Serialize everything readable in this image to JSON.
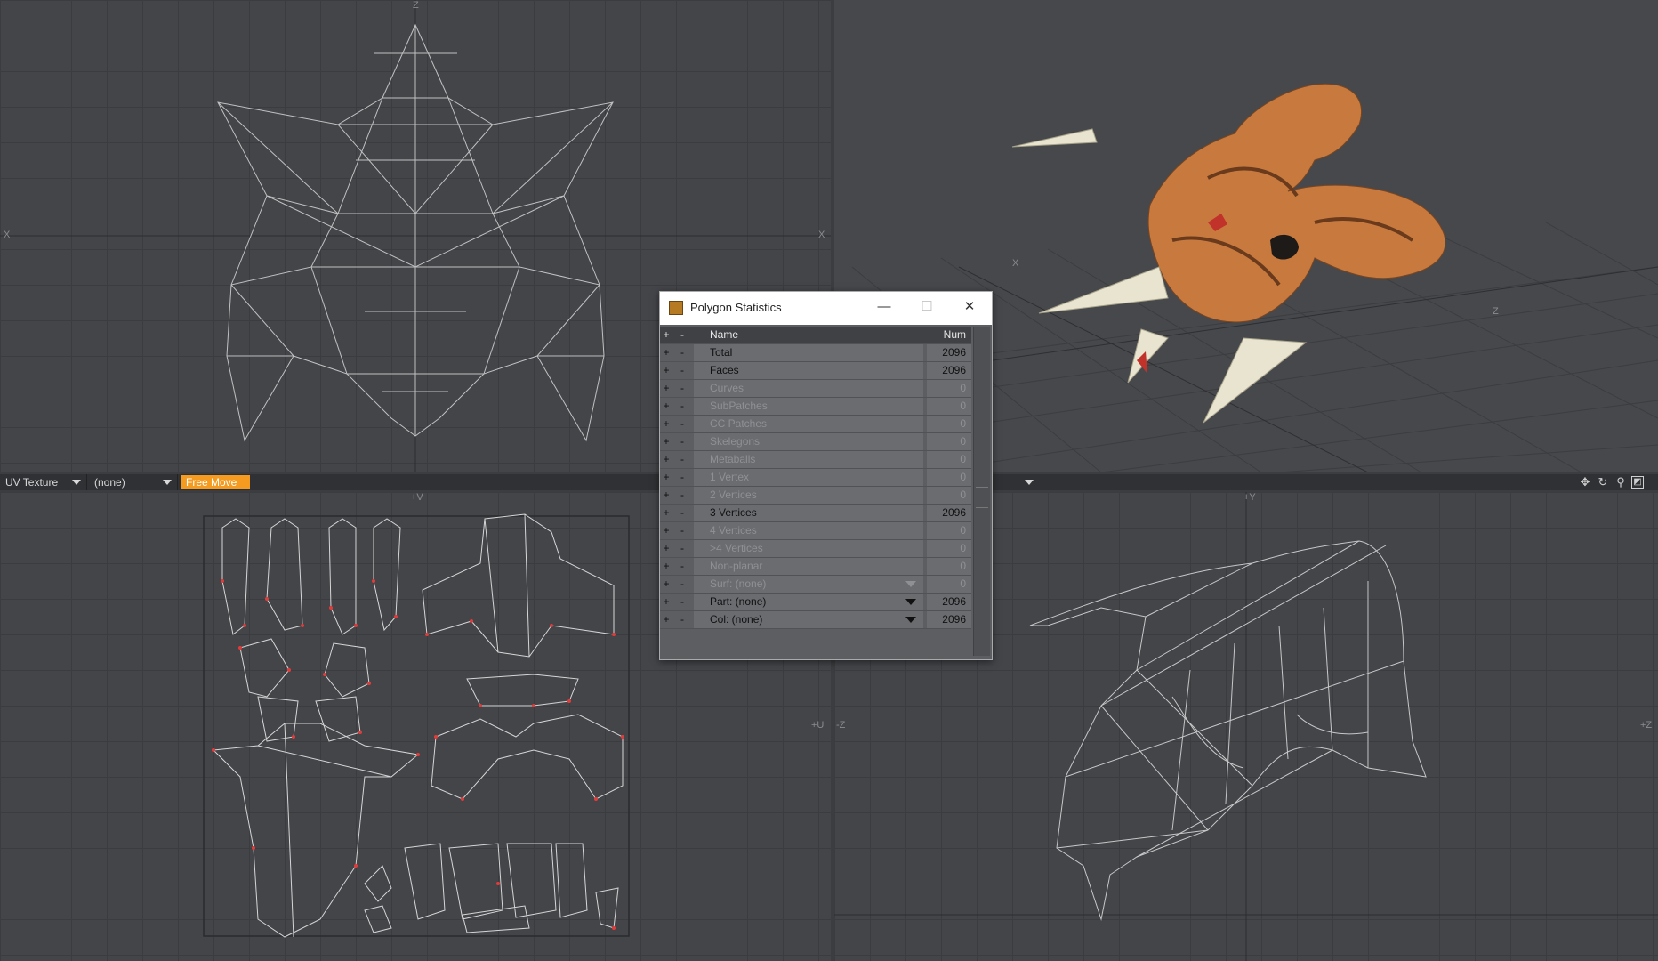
{
  "toolbar": {
    "uv_texture_label": "UV Texture",
    "none_label": "(none)",
    "free_move_label": "Free Move"
  },
  "viewport_labels": {
    "top_z": "Z",
    "top_x_left": "X",
    "top_x_right": "X",
    "bottom_v": "+V",
    "bottom_u": "+U",
    "right_y": "+Y",
    "right_z_left": "-Z",
    "right_z_right": "+Z",
    "persp_x": "X",
    "persp_z": "Z"
  },
  "tool_icons": [
    "move-view-icon",
    "rotate-view-icon",
    "zoom-view-icon",
    "maximize-view-icon"
  ],
  "dialog": {
    "title": "Polygon Statistics",
    "minimize": "—",
    "maximize": "☐",
    "close": "✕",
    "columns": {
      "plus": "+",
      "minus": "-",
      "name": "Name",
      "num": "Num"
    },
    "rows": [
      {
        "plus": "+",
        "minus": "-",
        "name": "Total",
        "num": "2096",
        "active": true
      },
      {
        "plus": "+",
        "minus": "-",
        "name": "Faces",
        "num": "2096",
        "active": true
      },
      {
        "plus": "+",
        "minus": "-",
        "name": "Curves",
        "num": "0",
        "active": false
      },
      {
        "plus": "+",
        "minus": "-",
        "name": "SubPatches",
        "num": "0",
        "active": false
      },
      {
        "plus": "+",
        "minus": "-",
        "name": "CC Patches",
        "num": "0",
        "active": false
      },
      {
        "plus": "+",
        "minus": "-",
        "name": "Skelegons",
        "num": "0",
        "active": false
      },
      {
        "plus": "+",
        "minus": "-",
        "name": "Metaballs",
        "num": "0",
        "active": false
      },
      {
        "plus": "+",
        "minus": "-",
        "name": "1 Vertex",
        "num": "0",
        "active": false
      },
      {
        "plus": "+",
        "minus": "-",
        "name": "2 Vertices",
        "num": "0",
        "active": false
      },
      {
        "plus": "+",
        "minus": "-",
        "name": "3 Vertices",
        "num": "2096",
        "active": true
      },
      {
        "plus": "+",
        "minus": "-",
        "name": "4 Vertices",
        "num": "0",
        "active": false
      },
      {
        "plus": "+",
        "minus": "-",
        "name": ">4 Vertices",
        "num": "0",
        "active": false
      },
      {
        "plus": "+",
        "minus": "-",
        "name": "Non-planar",
        "num": "0",
        "active": false
      },
      {
        "plus": "+",
        "minus": "-",
        "name": "Surf: (none)",
        "num": "0",
        "active": false,
        "dropdown": true
      },
      {
        "plus": "+",
        "minus": "-",
        "name": "Part: (none)",
        "num": "2096",
        "active": true,
        "dropdown": true
      },
      {
        "plus": "+",
        "minus": "-",
        "name": "Col: (none)",
        "num": "2096",
        "active": true,
        "dropdown": true
      }
    ]
  },
  "colors": {
    "accent": "#f49b20",
    "viewport_bg": "#434549",
    "wire": "#d6d6d6",
    "uv_seam": "#e23b3b",
    "model_skin": "#c87a3e",
    "horn": "#e8e4d0"
  }
}
